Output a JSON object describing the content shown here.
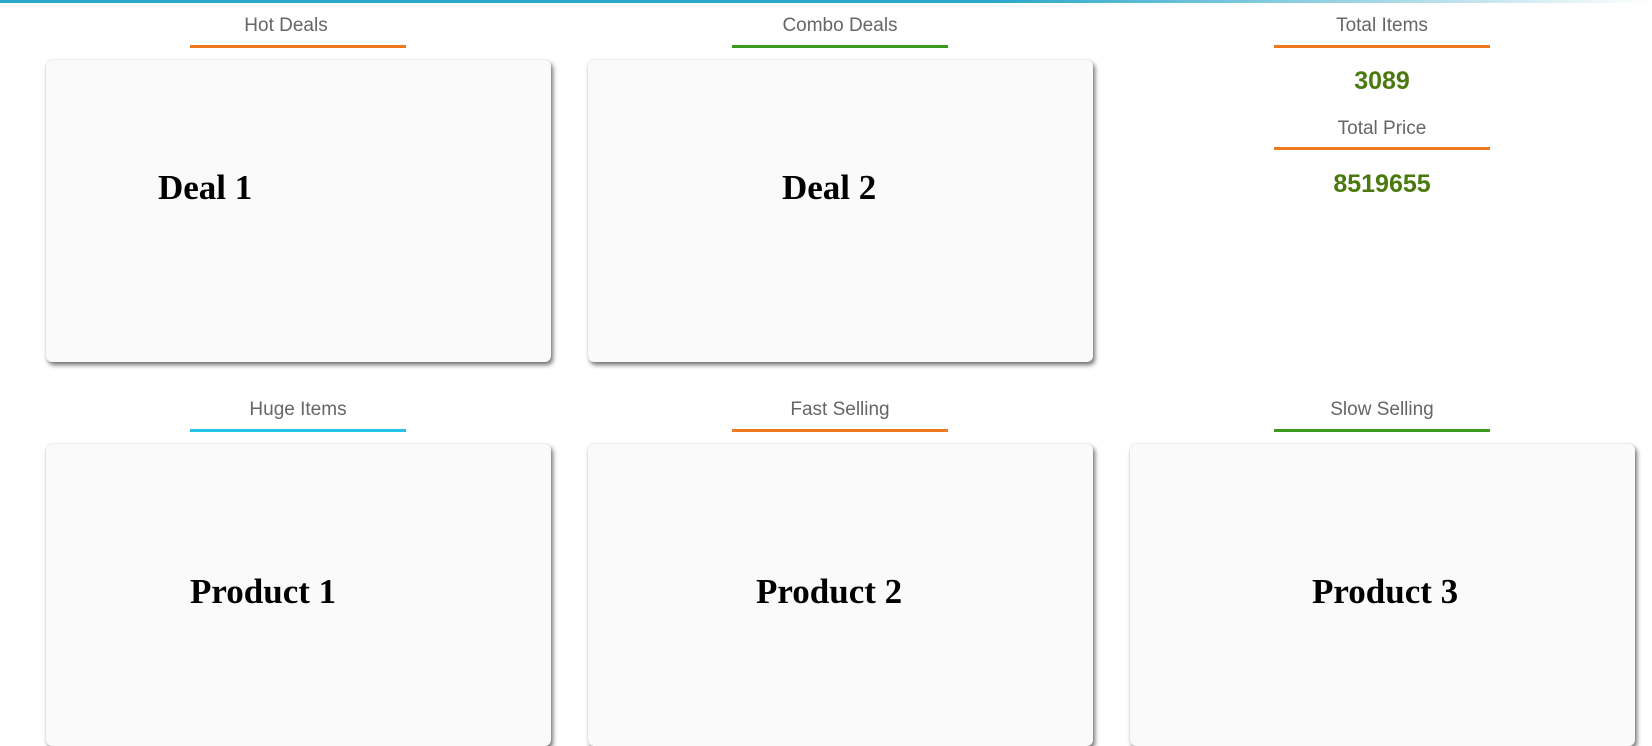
{
  "colors": {
    "orange": "#f0781e",
    "green": "#3a9a1e",
    "cyan": "#22c3e6",
    "value_green": "#4a7a0d",
    "top_rule": "#2aa7c9"
  },
  "sections": {
    "hot_deals": {
      "title": "Hot Deals",
      "card_label": "Deal 1",
      "accent": "orange"
    },
    "combo_deals": {
      "title": "Combo Deals",
      "card_label": "Deal 2",
      "accent": "green"
    },
    "huge_items": {
      "title": "Huge Items",
      "card_label": "Product 1",
      "accent": "cyan"
    },
    "fast_selling": {
      "title": "Fast Selling",
      "card_label": "Product 2",
      "accent": "orange"
    },
    "slow_selling": {
      "title": "Slow Selling",
      "card_label": "Product 3",
      "accent": "green"
    }
  },
  "stats": {
    "total_items": {
      "label": "Total Items",
      "value": "3089",
      "accent": "orange"
    },
    "total_price": {
      "label": "Total Price",
      "value": "8519655",
      "accent": "orange"
    }
  }
}
